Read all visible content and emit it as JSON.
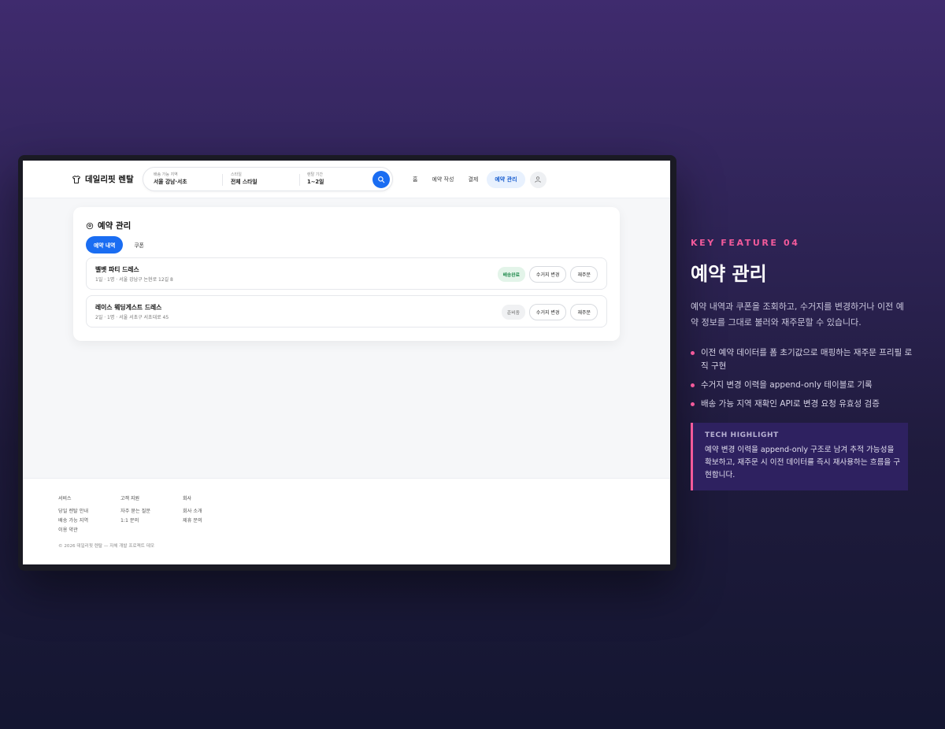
{
  "app": {
    "logo": "데일리핏 렌탈",
    "search": {
      "region_label": "배송 가능 지역",
      "region_value": "서울 강남·서초",
      "style_label": "스타일",
      "style_value": "전체 스타일",
      "period_label": "렌탈 기간",
      "period_value": "1~2일"
    },
    "nav": [
      "홈",
      "예약 작성",
      "결제",
      "예약 관리"
    ],
    "nav_active": "예약 관리"
  },
  "card": {
    "title": "예약 관리",
    "tabs": [
      "예약 내역",
      "쿠폰"
    ],
    "orders": [
      {
        "name": "벨벳 파티 드레스",
        "meta": "1일 · 1명 · 서울 강남구 논현로 12길 8",
        "status": "배송완료",
        "btn_change": "수거지 변경",
        "btn_reorder": "재주문"
      },
      {
        "name": "레이스 웨딩게스트 드레스",
        "meta": "2일 · 1명 · 서울 서초구 서초대로 45",
        "status": "준비중",
        "btn_change": "수거지 변경",
        "btn_reorder": "재주문"
      }
    ]
  },
  "footer": {
    "columns": [
      {
        "heading": "서비스",
        "links": [
          "당일 렌탈 안내",
          "배송 가능 지역",
          "이용 약관"
        ]
      },
      {
        "heading": "고객 지원",
        "links": [
          "자주 묻는 질문",
          "1:1 문의"
        ]
      },
      {
        "heading": "회사",
        "links": [
          "회사 소개",
          "제휴 문의"
        ]
      }
    ],
    "copyright": "© 2026 데일리핏 렌탈 — 자체 개발 프로젝트 데모"
  },
  "feature": {
    "eyebrow": "KEY FEATURE 04",
    "title": "예약 관리",
    "description": "예약 내역과 쿠폰을 조회하고, 수거지를 변경하거나 이전 예약 정보를 그대로 불러와 재주문할 수 있습니다.",
    "bullets": [
      "이전 예약 데이터를 폼 초기값으로 매핑하는 재주문 프리필 로직 구현",
      "수거지 변경 이력을 append-only 테이블로 기록",
      "배송 가능 지역 재확인 API로 변경 요청 유효성 검증"
    ],
    "tech_heading": "TECH HIGHLIGHT",
    "tech_body": "예약 변경 이력을 append-only 구조로 남겨 추적 가능성을 확보하고, 재주문 시 이전 데이터를 즉시 재사용하는 흐름을 구현합니다."
  },
  "colors": {
    "accent": "#1a6df2",
    "highlight": "#f35a9b",
    "status_done": "#1f8a4c"
  },
  "icons": [
    "shirt-icon",
    "search-icon",
    "user-icon",
    "clock-icon"
  ]
}
